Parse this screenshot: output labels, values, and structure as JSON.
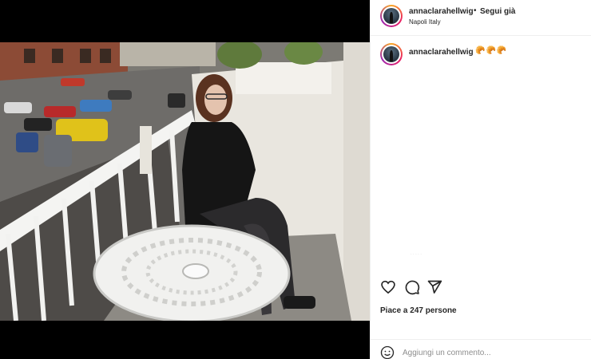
{
  "post": {
    "username": "annaclarahellwig",
    "separator": "•",
    "follow_label": "Segui già",
    "location": "Napoli Italy",
    "caption": {
      "username": "annaclarahellwig",
      "text": "🥐🥐🥐"
    },
    "hidden_comment": "· · · · ·",
    "likes_text": "Piace a 247 persone",
    "comment_placeholder": "Aggiungi un commento...",
    "photo_alt": "Foto su un balcone a Napoli"
  },
  "icons": {
    "like": "heart-icon",
    "comment": "comment-icon",
    "share": "paper-plane-icon",
    "emoji": "smiley-icon"
  },
  "colors": {
    "text": "#262626",
    "muted": "#8e8e8e",
    "divider": "#efefef",
    "photo_letterbox": "#000000"
  }
}
